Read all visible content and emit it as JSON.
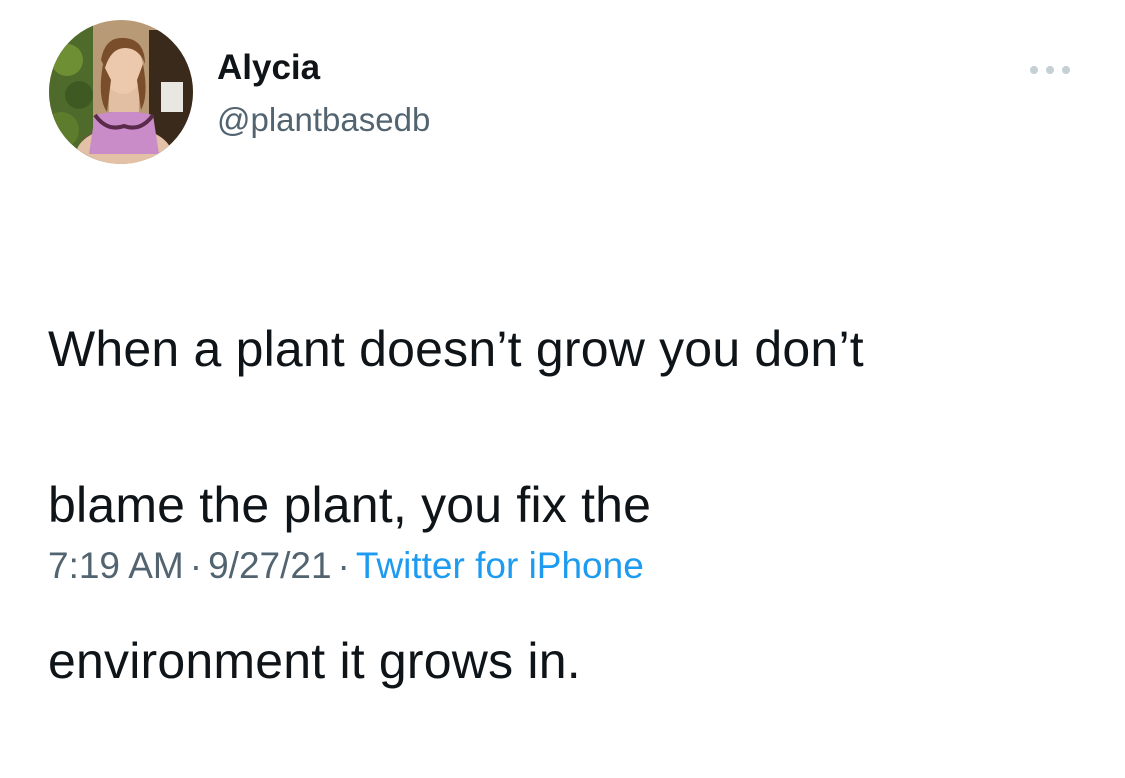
{
  "user": {
    "display_name": "Alycia",
    "handle": "@plantbasedb",
    "avatar_icon": "profile-photo"
  },
  "menu": {
    "icon": "more-options-icon"
  },
  "tweet": {
    "lines": [
      "When a plant doesn’t grow you don’t",
      "blame the plant, you fix the",
      "environment it grows in."
    ]
  },
  "meta": {
    "time": "7:19 AM",
    "separator": "·",
    "date": "9/27/21",
    "source": "Twitter for iPhone"
  },
  "colors": {
    "text_primary": "#0f1419",
    "text_secondary": "#536471",
    "link": "#1d9bf0",
    "background": "#ffffff"
  }
}
